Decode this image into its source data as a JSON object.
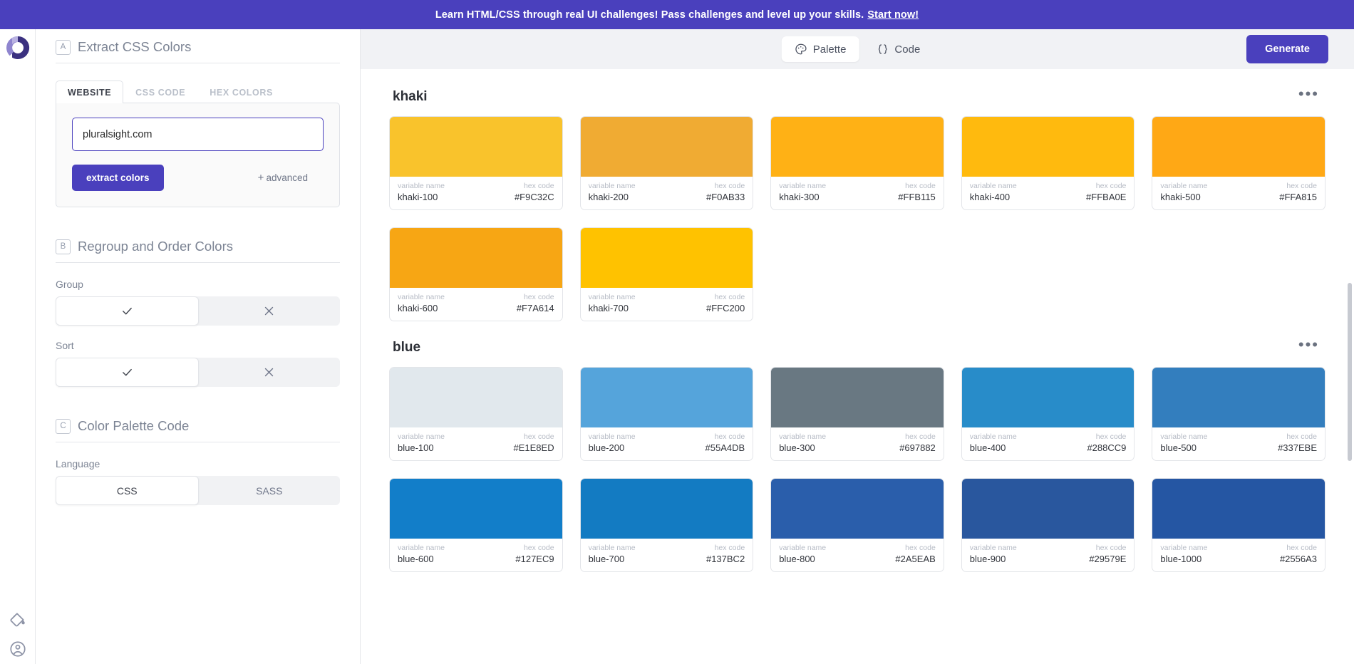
{
  "promo": {
    "text": "Learn HTML/CSS through real UI challenges! Pass challenges and level up your skills.",
    "link_label": "Start now!"
  },
  "rail": {
    "logo_name": "app-logo",
    "bottom_icons": [
      "paint-bucket-icon",
      "account-circle-icon"
    ]
  },
  "panel": {
    "section_a": {
      "letter": "A",
      "title": "Extract CSS Colors",
      "tabs": [
        {
          "label": "WEBSITE",
          "active": true
        },
        {
          "label": "CSS CODE",
          "active": false
        },
        {
          "label": "HEX COLORS",
          "active": false
        }
      ],
      "input": {
        "value": "pluralsight.com",
        "placeholder": "pluralsight.com"
      },
      "extract_label": "extract colors",
      "advanced_label": "advanced",
      "advanced_plus": "+"
    },
    "section_b": {
      "letter": "B",
      "title": "Regroup and Order Colors",
      "group": {
        "label": "Group",
        "on_icon": "check-icon",
        "off_icon": "close-icon",
        "selected": "on"
      },
      "sort": {
        "label": "Sort",
        "on_icon": "check-icon",
        "off_icon": "close-icon",
        "selected": "on"
      }
    },
    "section_c": {
      "letter": "C",
      "title": "Color Palette Code",
      "language": {
        "label": "Language",
        "options": [
          "CSS",
          "SASS"
        ],
        "selected": "CSS"
      }
    }
  },
  "topbar": {
    "tabs": [
      {
        "label": "Palette",
        "icon": "palette-icon",
        "active": true
      },
      {
        "label": "Code",
        "icon": "braces-icon",
        "active": false
      }
    ],
    "generate_label": "Generate"
  },
  "swatch_labels": {
    "name": "variable name",
    "hex": "hex code"
  },
  "menu_glyph": "•••",
  "groups": [
    {
      "name": "khaki",
      "colors": [
        {
          "name": "khaki-100",
          "hex": "#F9C32C"
        },
        {
          "name": "khaki-200",
          "hex": "#F0AB33"
        },
        {
          "name": "khaki-300",
          "hex": "#FFB115"
        },
        {
          "name": "khaki-400",
          "hex": "#FFBA0E"
        },
        {
          "name": "khaki-500",
          "hex": "#FFA815"
        },
        {
          "name": "khaki-600",
          "hex": "#F7A614"
        },
        {
          "name": "khaki-700",
          "hex": "#FFC200"
        }
      ]
    },
    {
      "name": "blue",
      "colors": [
        {
          "name": "blue-100",
          "hex": "#E1E8ED"
        },
        {
          "name": "blue-200",
          "hex": "#55A4DB"
        },
        {
          "name": "blue-300",
          "hex": "#697882"
        },
        {
          "name": "blue-400",
          "hex": "#288CC9"
        },
        {
          "name": "blue-500",
          "hex": "#337EBE"
        },
        {
          "name": "blue-600",
          "hex": "#127EC9"
        },
        {
          "name": "blue-700",
          "hex": "#137BC2"
        },
        {
          "name": "blue-800",
          "hex": "#2A5EAB"
        },
        {
          "name": "blue-900",
          "hex": "#29579E"
        },
        {
          "name": "blue-1000",
          "hex": "#2556A3"
        }
      ]
    }
  ],
  "theme": {
    "brand": "#4a40bd",
    "topbar_bg": "#f1f2f5",
    "muted_text": "#7c8494"
  }
}
